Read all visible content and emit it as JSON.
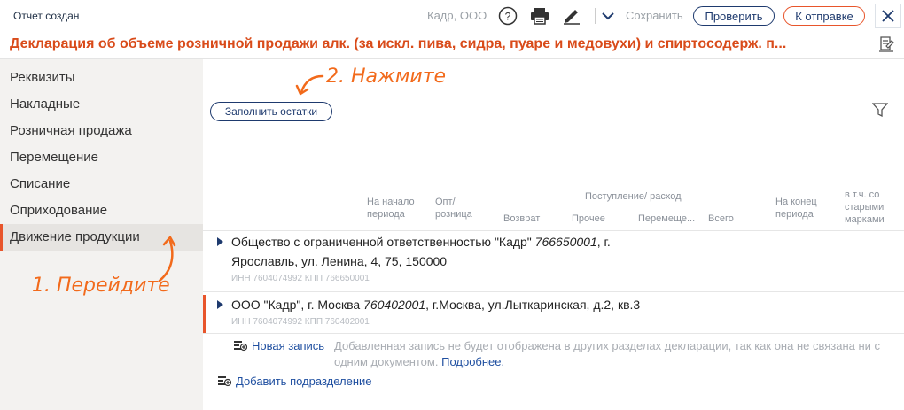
{
  "header": {
    "status": "Отчет создан",
    "org": "Кадр, ООО",
    "save_label": "Сохранить",
    "check_label": "Проверить",
    "send_label": "К отправке"
  },
  "title": "Декларация об объеме розничной продажи алк. (за искл. пива, сидра, пуаре и медовухи) и спиртосодерж. п...",
  "sidebar": {
    "items": [
      {
        "label": "Реквизиты"
      },
      {
        "label": "Накладные"
      },
      {
        "label": "Розничная продажа"
      },
      {
        "label": "Перемещение"
      },
      {
        "label": "Списание"
      },
      {
        "label": "Оприходование"
      },
      {
        "label": "Движение продукции"
      }
    ],
    "active_index": 6
  },
  "annotations": {
    "step1": "1. Перейдите",
    "step2": "2. Нажмите"
  },
  "toolbar": {
    "fill_label": "Заполнить остатки"
  },
  "columns": {
    "start_line1": "На начало",
    "start_line2": "периода",
    "opt_line1": "Опт/",
    "opt_line2": "розница",
    "group": "Поступление/ расход",
    "return": "Возврат",
    "other": "Прочее",
    "move": "Перемеще...",
    "total": "Всего",
    "end_line1": "На конец",
    "end_line2": "периода",
    "old_line1": "в т.ч. со",
    "old_line2": "старыми",
    "old_line3": "марками"
  },
  "rows": [
    {
      "name_prefix": "Общество с ограниченной ответственностью \"Кадр\" ",
      "kpp": "766650001",
      "name_suffix": ", г.",
      "address": "Ярославль, ул. Ленина, 4, 75, 150000",
      "inn": "ИНН 7604074992 КПП 766650001"
    },
    {
      "name_prefix": "ООО \"Кадр\", г. Москва ",
      "kpp": "760402001",
      "name_suffix": ", г.Москва, ул.Лыткаринская, д.2, кв.3",
      "inn": "ИНН 7604074992 КПП 760402001"
    }
  ],
  "new_record": {
    "label": "Новая запись",
    "note": "Добавленная запись не будет отображена в других разделах декларации, так как она не связана ни с одним документом.",
    "more": "Подробнее."
  },
  "add_division": "Добавить подразделение",
  "colors": {
    "accent": "#e8552b",
    "title": "#d94b1a",
    "link": "#1f4fa0",
    "navy": "#1e3a6e"
  }
}
